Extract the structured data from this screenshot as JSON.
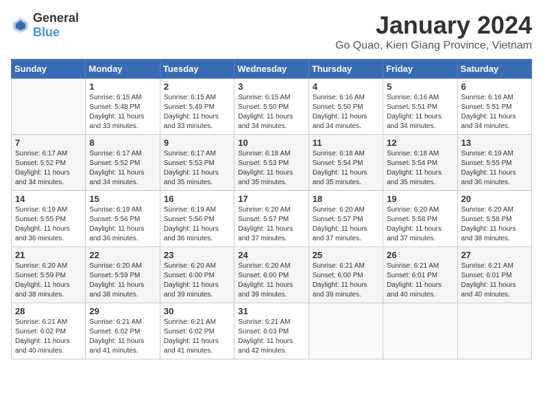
{
  "logo": {
    "general": "General",
    "blue": "Blue"
  },
  "header": {
    "title": "January 2024",
    "subtitle": "Go Quao, Kien Giang Province, Vietnam"
  },
  "weekdays": [
    "Sunday",
    "Monday",
    "Tuesday",
    "Wednesday",
    "Thursday",
    "Friday",
    "Saturday"
  ],
  "weeks": [
    [
      {
        "day": "",
        "sunrise": "",
        "sunset": "",
        "daylight": ""
      },
      {
        "day": "1",
        "sunrise": "Sunrise: 6:15 AM",
        "sunset": "Sunset: 5:48 PM",
        "daylight": "Daylight: 11 hours and 33 minutes."
      },
      {
        "day": "2",
        "sunrise": "Sunrise: 6:15 AM",
        "sunset": "Sunset: 5:49 PM",
        "daylight": "Daylight: 11 hours and 33 minutes."
      },
      {
        "day": "3",
        "sunrise": "Sunrise: 6:15 AM",
        "sunset": "Sunset: 5:50 PM",
        "daylight": "Daylight: 11 hours and 34 minutes."
      },
      {
        "day": "4",
        "sunrise": "Sunrise: 6:16 AM",
        "sunset": "Sunset: 5:50 PM",
        "daylight": "Daylight: 11 hours and 34 minutes."
      },
      {
        "day": "5",
        "sunrise": "Sunrise: 6:16 AM",
        "sunset": "Sunset: 5:51 PM",
        "daylight": "Daylight: 11 hours and 34 minutes."
      },
      {
        "day": "6",
        "sunrise": "Sunrise: 6:16 AM",
        "sunset": "Sunset: 5:51 PM",
        "daylight": "Daylight: 11 hours and 34 minutes."
      }
    ],
    [
      {
        "day": "7",
        "sunrise": "Sunrise: 6:17 AM",
        "sunset": "Sunset: 5:52 PM",
        "daylight": "Daylight: 11 hours and 34 minutes."
      },
      {
        "day": "8",
        "sunrise": "Sunrise: 6:17 AM",
        "sunset": "Sunset: 5:52 PM",
        "daylight": "Daylight: 11 hours and 34 minutes."
      },
      {
        "day": "9",
        "sunrise": "Sunrise: 6:17 AM",
        "sunset": "Sunset: 5:53 PM",
        "daylight": "Daylight: 11 hours and 35 minutes."
      },
      {
        "day": "10",
        "sunrise": "Sunrise: 6:18 AM",
        "sunset": "Sunset: 5:53 PM",
        "daylight": "Daylight: 11 hours and 35 minutes."
      },
      {
        "day": "11",
        "sunrise": "Sunrise: 6:18 AM",
        "sunset": "Sunset: 5:54 PM",
        "daylight": "Daylight: 11 hours and 35 minutes."
      },
      {
        "day": "12",
        "sunrise": "Sunrise: 6:18 AM",
        "sunset": "Sunset: 5:54 PM",
        "daylight": "Daylight: 11 hours and 35 minutes."
      },
      {
        "day": "13",
        "sunrise": "Sunrise: 6:19 AM",
        "sunset": "Sunset: 5:55 PM",
        "daylight": "Daylight: 11 hours and 36 minutes."
      }
    ],
    [
      {
        "day": "14",
        "sunrise": "Sunrise: 6:19 AM",
        "sunset": "Sunset: 5:55 PM",
        "daylight": "Daylight: 11 hours and 36 minutes."
      },
      {
        "day": "15",
        "sunrise": "Sunrise: 6:19 AM",
        "sunset": "Sunset: 5:56 PM",
        "daylight": "Daylight: 11 hours and 36 minutes."
      },
      {
        "day": "16",
        "sunrise": "Sunrise: 6:19 AM",
        "sunset": "Sunset: 5:56 PM",
        "daylight": "Daylight: 11 hours and 36 minutes."
      },
      {
        "day": "17",
        "sunrise": "Sunrise: 6:20 AM",
        "sunset": "Sunset: 5:57 PM",
        "daylight": "Daylight: 11 hours and 37 minutes."
      },
      {
        "day": "18",
        "sunrise": "Sunrise: 6:20 AM",
        "sunset": "Sunset: 5:57 PM",
        "daylight": "Daylight: 11 hours and 37 minutes."
      },
      {
        "day": "19",
        "sunrise": "Sunrise: 6:20 AM",
        "sunset": "Sunset: 5:58 PM",
        "daylight": "Daylight: 11 hours and 37 minutes."
      },
      {
        "day": "20",
        "sunrise": "Sunrise: 6:20 AM",
        "sunset": "Sunset: 5:58 PM",
        "daylight": "Daylight: 11 hours and 38 minutes."
      }
    ],
    [
      {
        "day": "21",
        "sunrise": "Sunrise: 6:20 AM",
        "sunset": "Sunset: 5:59 PM",
        "daylight": "Daylight: 11 hours and 38 minutes."
      },
      {
        "day": "22",
        "sunrise": "Sunrise: 6:20 AM",
        "sunset": "Sunset: 5:59 PM",
        "daylight": "Daylight: 11 hours and 38 minutes."
      },
      {
        "day": "23",
        "sunrise": "Sunrise: 6:20 AM",
        "sunset": "Sunset: 6:00 PM",
        "daylight": "Daylight: 11 hours and 39 minutes."
      },
      {
        "day": "24",
        "sunrise": "Sunrise: 6:20 AM",
        "sunset": "Sunset: 6:00 PM",
        "daylight": "Daylight: 11 hours and 39 minutes."
      },
      {
        "day": "25",
        "sunrise": "Sunrise: 6:21 AM",
        "sunset": "Sunset: 6:00 PM",
        "daylight": "Daylight: 11 hours and 39 minutes."
      },
      {
        "day": "26",
        "sunrise": "Sunrise: 6:21 AM",
        "sunset": "Sunset: 6:01 PM",
        "daylight": "Daylight: 11 hours and 40 minutes."
      },
      {
        "day": "27",
        "sunrise": "Sunrise: 6:21 AM",
        "sunset": "Sunset: 6:01 PM",
        "daylight": "Daylight: 11 hours and 40 minutes."
      }
    ],
    [
      {
        "day": "28",
        "sunrise": "Sunrise: 6:21 AM",
        "sunset": "Sunset: 6:02 PM",
        "daylight": "Daylight: 11 hours and 40 minutes."
      },
      {
        "day": "29",
        "sunrise": "Sunrise: 6:21 AM",
        "sunset": "Sunset: 6:02 PM",
        "daylight": "Daylight: 11 hours and 41 minutes."
      },
      {
        "day": "30",
        "sunrise": "Sunrise: 6:21 AM",
        "sunset": "Sunset: 6:02 PM",
        "daylight": "Daylight: 11 hours and 41 minutes."
      },
      {
        "day": "31",
        "sunrise": "Sunrise: 6:21 AM",
        "sunset": "Sunset: 6:03 PM",
        "daylight": "Daylight: 11 hours and 42 minutes."
      },
      {
        "day": "",
        "sunrise": "",
        "sunset": "",
        "daylight": ""
      },
      {
        "day": "",
        "sunrise": "",
        "sunset": "",
        "daylight": ""
      },
      {
        "day": "",
        "sunrise": "",
        "sunset": "",
        "daylight": ""
      }
    ]
  ]
}
